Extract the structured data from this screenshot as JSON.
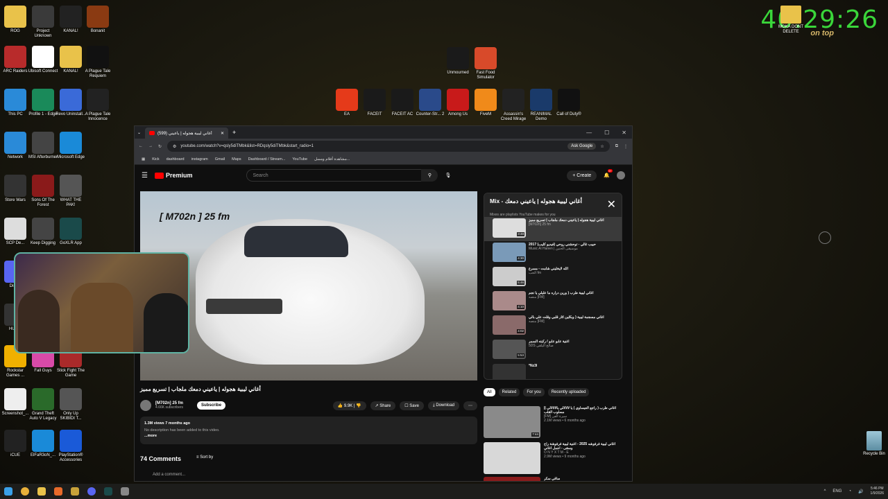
{
  "clock": {
    "time": "40:29:26",
    "ontop": "on top"
  },
  "moka": {
    "label": "MOKA DONT DELETE"
  },
  "desktop_icons": [
    {
      "label": "ROG",
      "color": "#e9c24a"
    },
    {
      "label": "Project Unknown",
      "color": "#3a3a3a"
    },
    {
      "label": "KANAL!",
      "color": "#222"
    },
    {
      "label": "Bonanit",
      "color": "#8a3a12"
    },
    {
      "label": "ARC Raiders",
      "color": "#b82b2b"
    },
    {
      "label": "Ubisoft Connect",
      "color": "#fff"
    },
    {
      "label": "KANAL!",
      "color": "#e9c24a"
    },
    {
      "label": "A Plague Tale Requiem",
      "color": "#111"
    },
    {
      "label": "This PC",
      "color": "#2a8ad8"
    },
    {
      "label": "Profile 1 - Edge",
      "color": "#1a8a5a"
    },
    {
      "label": "Revo Uninstall...",
      "color": "#3a6ad8"
    },
    {
      "label": "A Plague Tale Innocence",
      "color": "#222"
    },
    {
      "label": "Network",
      "color": "#2a8ad8"
    },
    {
      "label": "MSI Afterburner",
      "color": "#444"
    },
    {
      "label": "Microsoft Edge",
      "color": "#1a8ad8"
    },
    {
      "label": "Store Wars",
      "color": "#333"
    },
    {
      "label": "Sons Of The Forest",
      "color": "#8a1a1a"
    },
    {
      "label": "WHAT THE PAK!",
      "color": "#555"
    },
    {
      "label": "SCP De...",
      "color": "#ddd"
    },
    {
      "label": "Keep Digging",
      "color": "#444"
    },
    {
      "label": "GoXLR App",
      "color": "#1a4a4a"
    },
    {
      "label": "Disc...",
      "color": "#5865f2"
    },
    {
      "label": "HUD...",
      "color": "#333"
    },
    {
      "label": "Rockstar Games ...",
      "color": "#f0b000"
    },
    {
      "label": "Fall Guys",
      "color": "#d84aa8"
    },
    {
      "label": "Stick Fight The Game",
      "color": "#aa2a2a"
    },
    {
      "label": "Screenshot_...",
      "color": "#eee"
    },
    {
      "label": "Grand Theft Auto V Legacy",
      "color": "#2a6a2a"
    },
    {
      "label": "Only Up SKIBIDI T...",
      "color": "#555"
    },
    {
      "label": "iCUE",
      "color": "#222"
    },
    {
      "label": "ElFaR3oN_...",
      "color": "#1a8ad8"
    },
    {
      "label": "PlayStation® Accessories",
      "color": "#1a5ad8"
    }
  ],
  "top_icons": [
    {
      "label": "Unmourned",
      "color": "#1a1a1a"
    },
    {
      "label": "Fast Food Simulator",
      "color": "#d84a2a"
    },
    {
      "label": "EA",
      "color": "#e53a1a"
    },
    {
      "label": "FACEIT",
      "color": "#1a1a1a"
    },
    {
      "label": "FACEIT AC",
      "color": "#1a1a1a"
    },
    {
      "label": "Counter-Str... 2",
      "color": "#2a4a8a"
    },
    {
      "label": "Among Us",
      "color": "#c81a1a"
    },
    {
      "label": "FiveM",
      "color": "#f08a1a"
    },
    {
      "label": "Assassin's Creed Mirage",
      "color": "#222"
    },
    {
      "label": "REANIMAL Demo",
      "color": "#1a3a6a"
    },
    {
      "label": "Call of Duty®",
      "color": "#111"
    }
  ],
  "browser": {
    "tab_title": "(599) أغاني ليبية هجوله | ياعيني",
    "url": "youtube.com/watch?v=qsly5diTMbk&list=RDqsly5diTMbk&start_radio=1",
    "ask_google": "Ask Google",
    "bookmarks": [
      "Kick",
      "dashboard",
      "instagram",
      "Gmail",
      "Maps",
      "Dashboard / Stream...",
      "YouTube",
      "مشاهدة أفلام ومسل..."
    ]
  },
  "yt": {
    "logo": "Premium",
    "search_placeholder": "Search",
    "create": "Create",
    "notif_count": "9+",
    "video_tag": "[ M702n ] 25 fm",
    "title": "أغاني ليبية هجوله | ياعيني دمعك ملجاب | تسريع مميز",
    "channel": "[M702n] 25 fm",
    "subscribers": "4.66K subscribers",
    "subscribe": "Subscribe",
    "likes": "9.9K",
    "share": "Share",
    "save": "Save",
    "download": "Download",
    "views": "1.3M views  7 months ago",
    "desc": "No description has been added to this video.",
    "more": "...more",
    "comments": "74 Comments",
    "sort": "Sort by",
    "add_comment": "Add a comment..."
  },
  "mix": {
    "title": "Mix - أغاني ليبية هجوله | ياعيني دمعك",
    "subtitle": "Mixes are playlists YouTube makes for you",
    "items": [
      {
        "title": "أغاني ليبية هجوله | ياعيني دمعك ملجاب | تسريع مميز",
        "channel": "[M702n] 25 fm",
        "dur": "3:48",
        "color": "#ddd"
      },
      {
        "title": "حبيب غالي - توحشني روحي (فيديو كليب) 2017",
        "channel": "Music Al Hanen | موسيقى الحنين",
        "dur": "4:30",
        "color": "#7a9ab8"
      },
      {
        "title": "الله لايخليني شامت - مسرع",
        "channel": "الحب fm",
        "dur": "5:46",
        "color": "#ccc"
      },
      {
        "title": "اغاني ليبية طرب ( ورين دراره ما عليلي يا نجم",
        "channel": "منصه [FM]",
        "dur": "4:10",
        "color": "#aa8a8a"
      },
      {
        "title": "اغاني مسجمة ليبية ( وبكلين اثار قلبي وقلت علي بالي",
        "channel": "منصه [FM]",
        "dur": "4:02",
        "color": "#8a6a6a"
      },
      {
        "title": "اغنية عابو عابو / ركبته السمر",
        "channel": "5DS صالح اليلقي",
        "dur": "5:53",
        "color": "#555"
      },
      {
        "title": "Nz3l*",
        "channel": "",
        "dur": "",
        "color": "#333"
      }
    ]
  },
  "chips": [
    "All",
    "Related",
    "For you",
    "Recently uploaded"
  ],
  "recs": [
    {
      "title": "اغاني طرب ( راجع العيساوي ) يا لالالالي يالالالالي || مسلوب القلب",
      "channel": "[FM] سيرة الفن",
      "meta": "2.1M views • 6 months ago",
      "dur": "7:44",
      "color": "#8a8a8a"
    },
    {
      "title": "اغاني ليبية فرفوشه 2025 - اغنية ليبية فرفوشة راح وسقى - اجمل اغاني",
      "channel": "O N Y X T M - E",
      "meta": "2.9M views • 9 months ago",
      "dur": "",
      "color": "#d8d8d8"
    },
    {
      "title": "ساقي سكر",
      "channel": "",
      "meta": "",
      "dur": "",
      "color": "#8a1a1a"
    }
  ],
  "taskbar": {
    "lang": "ENG",
    "time": "5:46 PM",
    "date": "1/9/2026"
  },
  "recycle": {
    "label": "Recycle Bin"
  }
}
